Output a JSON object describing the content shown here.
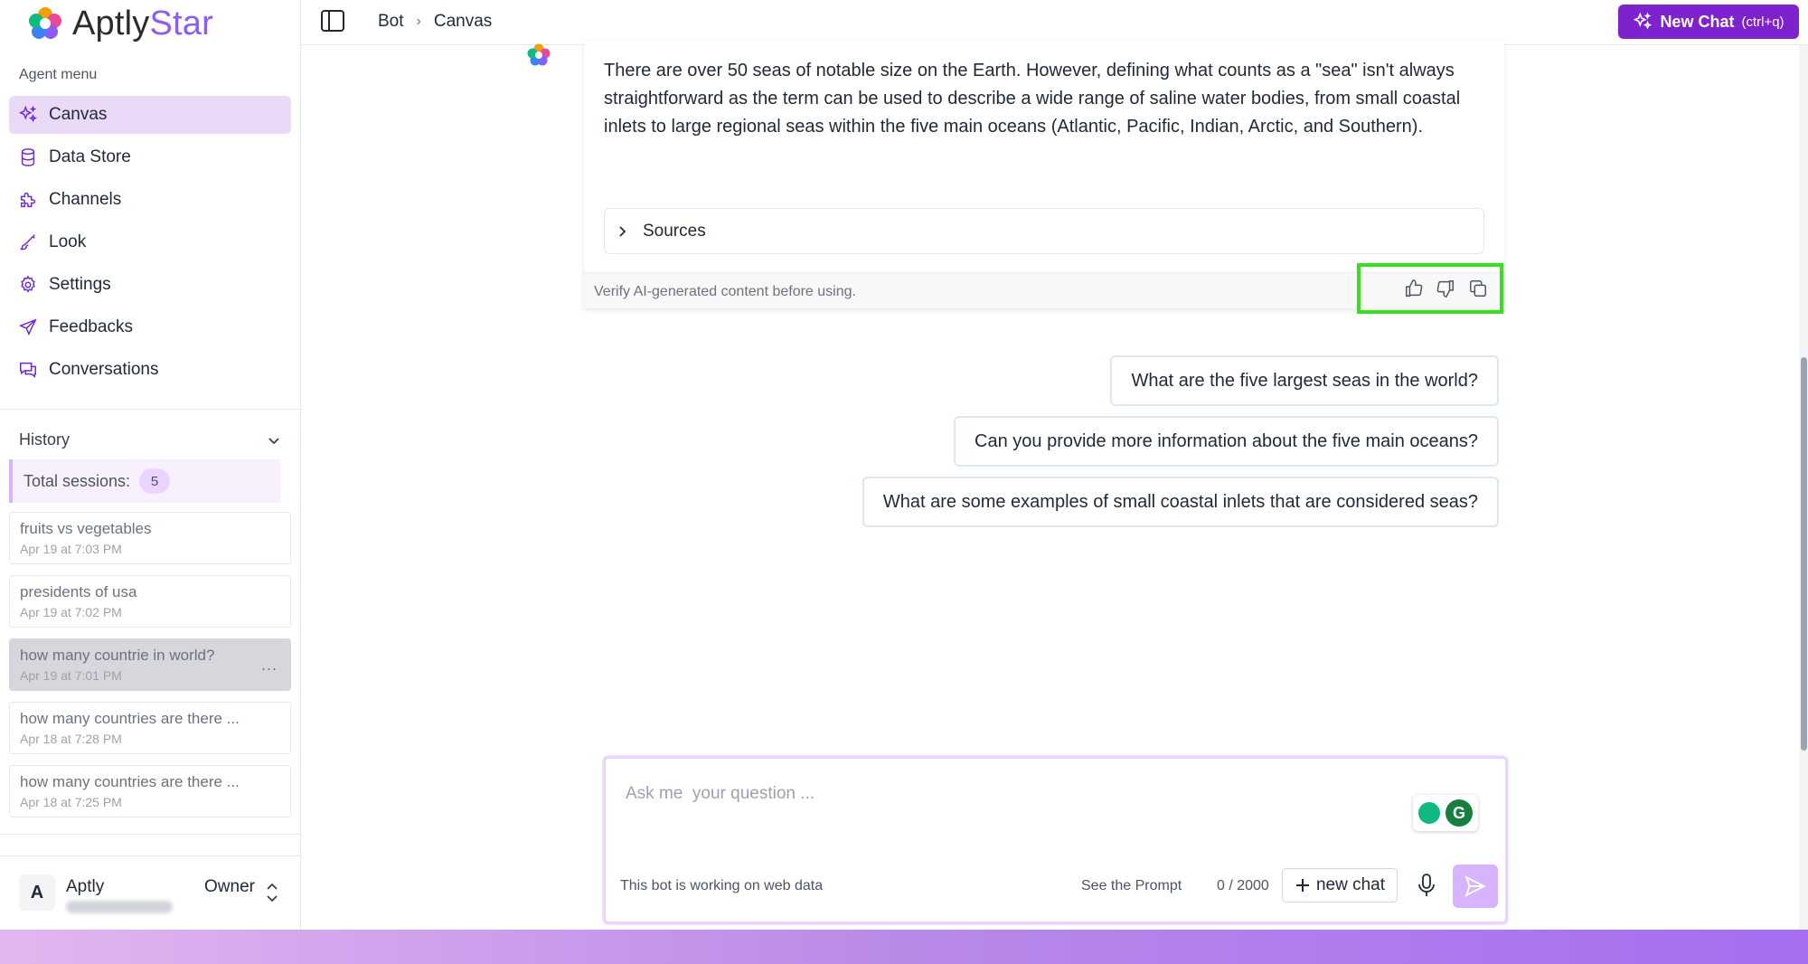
{
  "brand": {
    "name_part1": "Aptly",
    "name_part2": "Star"
  },
  "sidebar": {
    "section_label": "Agent menu",
    "items": [
      {
        "label": "Canvas",
        "icon": "sparkles-icon",
        "active": true
      },
      {
        "label": "Data Store",
        "icon": "database-icon",
        "active": false
      },
      {
        "label": "Channels",
        "icon": "puzzle-icon",
        "active": false
      },
      {
        "label": "Look",
        "icon": "brush-icon",
        "active": false
      },
      {
        "label": "Settings",
        "icon": "gear-icon",
        "active": false
      },
      {
        "label": "Feedbacks",
        "icon": "send-icon",
        "active": false
      },
      {
        "label": "Conversations",
        "icon": "chat-icon",
        "active": false
      }
    ],
    "history": {
      "title": "History",
      "sessions_label": "Total sessions:",
      "sessions_count": "5",
      "items": [
        {
          "title": "fruits vs vegetables",
          "time": "Apr 19 at 7:03 PM"
        },
        {
          "title": "presidents of usa",
          "time": "Apr 19 at 7:02 PM"
        },
        {
          "title": "how many countrie in world?",
          "time": "Apr 19 at 7:01 PM",
          "more": "..."
        },
        {
          "title": "how many countries are there ...",
          "time": "Apr 18 at 7:28 PM"
        },
        {
          "title": "how many countries are there ...",
          "time": "Apr 18 at 7:25 PM"
        }
      ]
    },
    "user": {
      "initial": "A",
      "name": "Aptly",
      "role": "Owner"
    }
  },
  "topbar": {
    "breadcrumb": [
      "Bot",
      "Canvas"
    ],
    "new_chat_label": "New Chat",
    "new_chat_hint": "(ctrl+q)"
  },
  "answer": {
    "text": "There are over 50 seas of notable size on the Earth. However, defining what counts as a \"sea\" isn't always straightforward as the term can be used to describe a wide range of saline water bodies, from small coastal inlets to large regional seas within the five main oceans (Atlantic, Pacific, Indian, Arctic, and Southern).",
    "sources_label": "Sources",
    "disclaimer": "Verify AI-generated content before using."
  },
  "suggestions": [
    "What are the five largest seas in the world?",
    "Can you provide more information about the five main oceans?",
    "What are some examples of small coastal inlets that are considered seas?"
  ],
  "composer": {
    "placeholder": "Ask me  your question ...",
    "status": "This bot is working on web data",
    "see_prompt": "See the Prompt",
    "char_count": "0 / 2000",
    "new_chat": "new chat"
  },
  "colors": {
    "accent": "#7e22ce",
    "active_menu_bg": "#ead9f7",
    "highlight_border": "#35e01e",
    "send_button": "#d8b4fe"
  }
}
